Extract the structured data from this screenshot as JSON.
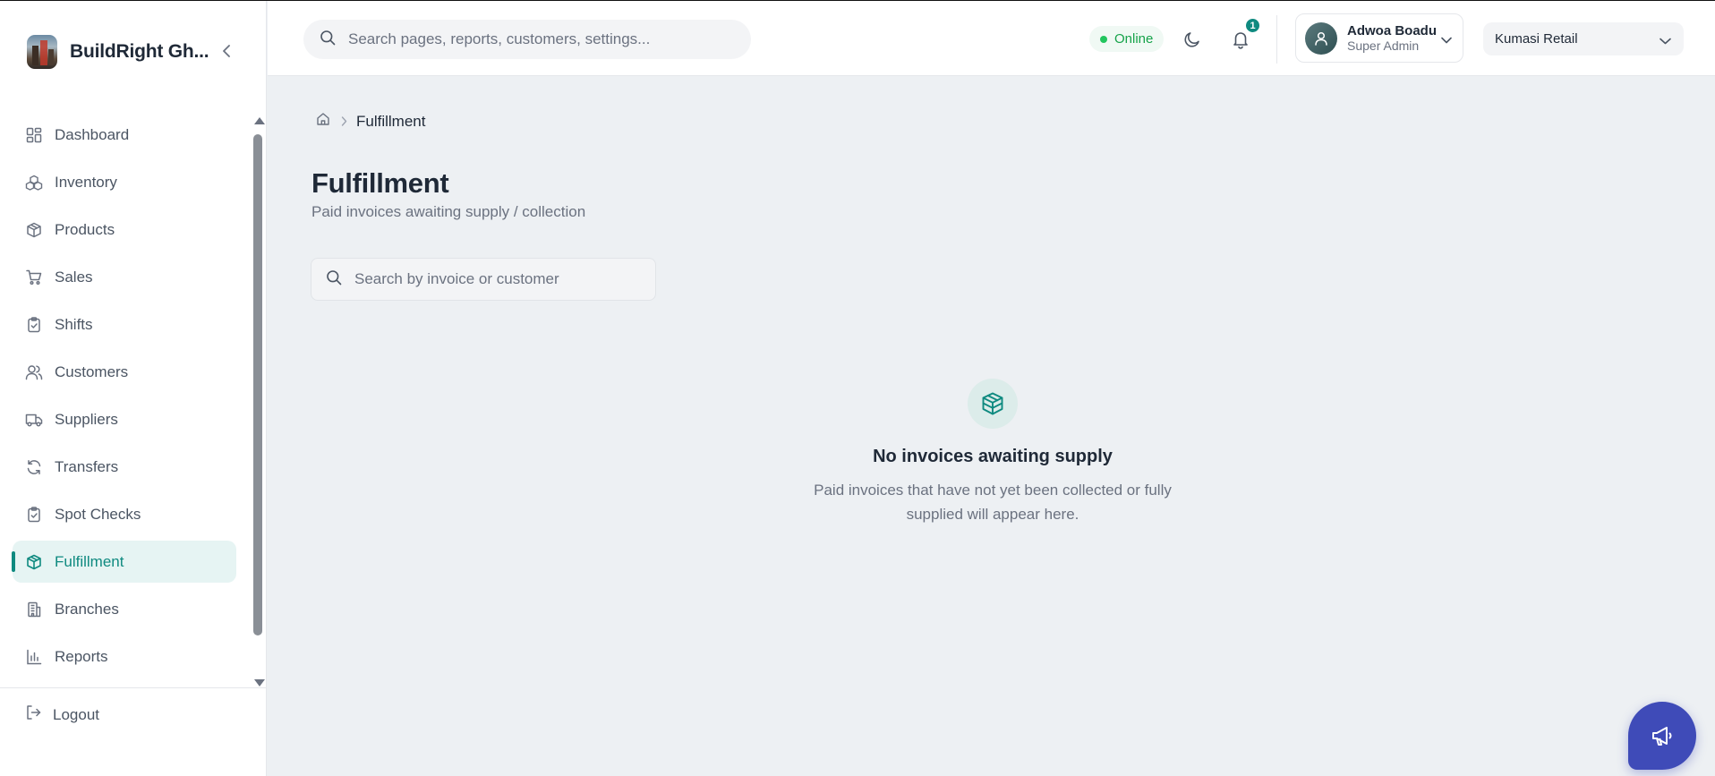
{
  "brand": {
    "name": "BuildRight Gh..."
  },
  "sidebar": {
    "items": [
      {
        "label": "Dashboard",
        "icon": "dashboard-icon"
      },
      {
        "label": "Inventory",
        "icon": "boxes-icon"
      },
      {
        "label": "Products",
        "icon": "package-icon"
      },
      {
        "label": "Sales",
        "icon": "cart-icon"
      },
      {
        "label": "Shifts",
        "icon": "clipboard-check-icon"
      },
      {
        "label": "Customers",
        "icon": "users-icon"
      },
      {
        "label": "Suppliers",
        "icon": "truck-icon"
      },
      {
        "label": "Transfers",
        "icon": "refresh-icon"
      },
      {
        "label": "Spot Checks",
        "icon": "clipboard-check-icon"
      },
      {
        "label": "Fulfillment",
        "icon": "package-icon",
        "active": true
      },
      {
        "label": "Branches",
        "icon": "building-icon"
      },
      {
        "label": "Reports",
        "icon": "bar-chart-icon"
      }
    ],
    "logout_label": "Logout"
  },
  "header": {
    "search_placeholder": "Search pages, reports, customers, settings...",
    "status_label": "Online",
    "notification_count": "1",
    "user": {
      "name": "Adwoa Boadu",
      "role": "Super Admin"
    },
    "branch": "Kumasi Retail"
  },
  "main": {
    "breadcrumb_current": "Fulfillment",
    "title": "Fulfillment",
    "subtitle": "Paid invoices awaiting supply / collection",
    "search_placeholder": "Search by invoice or customer",
    "empty_state": {
      "title": "No invoices awaiting supply",
      "text": "Paid invoices that have not yet been collected or fully supplied will appear here."
    }
  },
  "colors": {
    "accent": "#0f8a80",
    "accent_bg": "#e6f4f3",
    "online": "#16a34a",
    "fab": "#3f4bb8",
    "page_bg": "#edf0f3"
  }
}
